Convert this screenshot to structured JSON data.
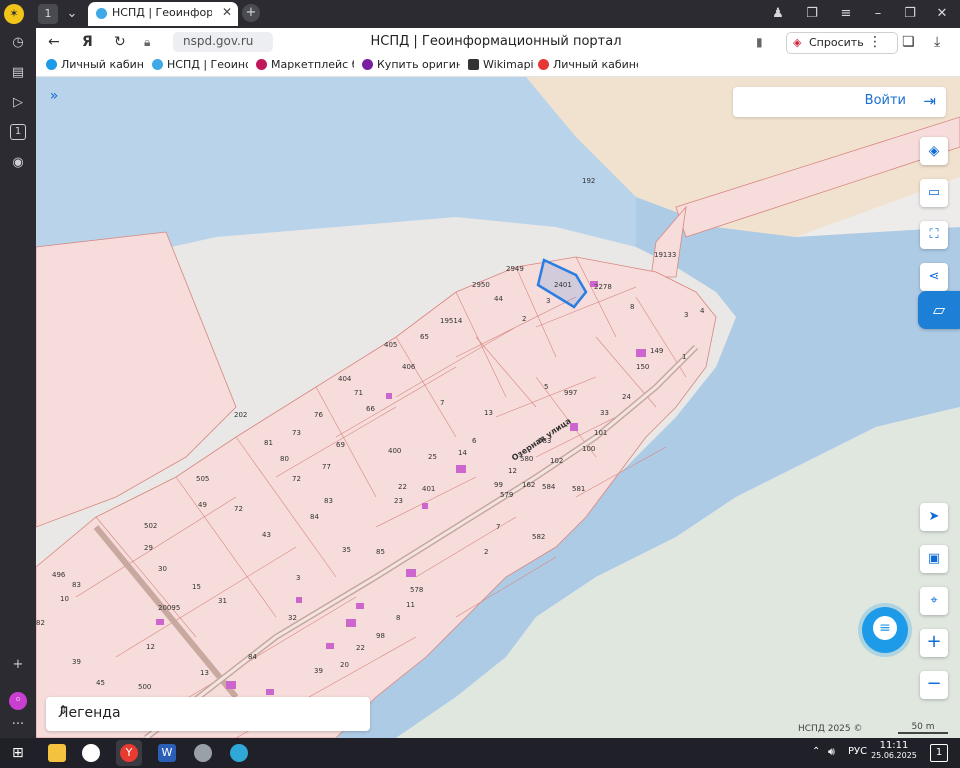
{
  "browser": {
    "tab_count": "1",
    "tab_title": "НСПД | Геоинформационный портал",
    "url": "nspd.gov.ru",
    "page_title": "НСПД | Геоинформационный портал",
    "ask_label": "Спросить"
  },
  "bookmarks": [
    {
      "label": "Личный кабинет",
      "color": "#1d9ae8"
    },
    {
      "label": "НСПД | Геоинфор",
      "color": "#3fa9e6"
    },
    {
      "label": "Маркетплейс бре",
      "color": "#c2185b"
    },
    {
      "label": "Купить оригинал",
      "color": "#7b1fa2"
    },
    {
      "label": "Wikimapia",
      "color": "#333333"
    },
    {
      "label": "Личный кабинет",
      "color": "#e53935"
    }
  ],
  "map": {
    "login_label": "Войти",
    "legend_label": "Легенда",
    "copyright": "НСПД 2025 ©",
    "scale_label": "50 m",
    "street_label": "Озерная улица",
    "colors": {
      "water": "#aecbe6",
      "parcel_fill": "#f6dcdb",
      "parcel_stroke": "#d9867f",
      "selected": "#2a7de1",
      "building": "#cc66cc"
    },
    "parcel_labels": [
      "192",
      "19133",
      "2949",
      "2950",
      "44",
      "2401",
      "2278",
      "3",
      "2",
      "19514",
      "8",
      "3",
      "4",
      "405",
      "65",
      "149",
      "1",
      "406",
      "404",
      "150",
      "71",
      "5",
      "997",
      "24",
      "66",
      "7",
      "76",
      "13",
      "33",
      "202",
      "73",
      "101",
      "81",
      "69",
      "6",
      "583",
      "100",
      "80",
      "400",
      "25",
      "580",
      "102",
      "77",
      "14",
      "72",
      "99",
      "12",
      "581",
      "505",
      "22",
      "162",
      "584",
      "401",
      "579",
      "83",
      "49",
      "84",
      "23",
      "72",
      "7",
      "502",
      "43",
      "582",
      "29",
      "35",
      "85",
      "2",
      "496",
      "30",
      "3",
      "578",
      "83",
      "15",
      "31",
      "11",
      "10",
      "20095",
      "32",
      "8",
      "82",
      "12",
      "98",
      "39",
      "84",
      "22",
      "45",
      "13",
      "39",
      "20",
      "500"
    ]
  },
  "taskbar": {
    "language": "РУС",
    "time": "11:11",
    "date": "25.06.2025",
    "notifications": "1"
  }
}
